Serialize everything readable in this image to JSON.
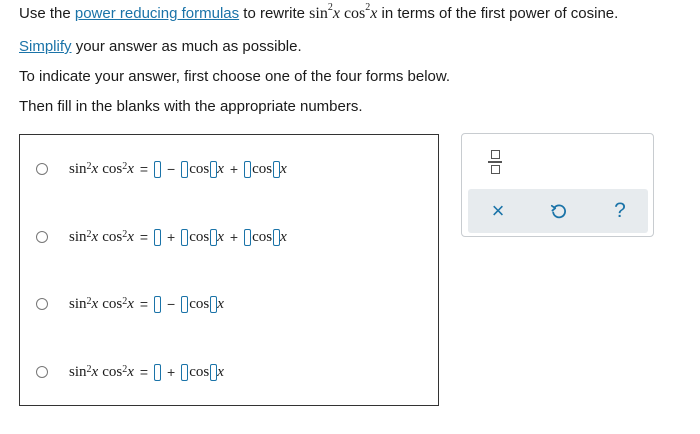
{
  "intro": {
    "prefix": "Use the",
    "link": "power reducing formulas",
    "middle": "to rewrite",
    "sin_fn": "sin",
    "exp": "2",
    "var": "x",
    "cos_fn": "cos",
    "suffix": "in terms of the first power of cosine."
  },
  "simplify": {
    "link": "Simplify",
    "rest": "your answer as much as possible."
  },
  "instruction1": "To indicate your answer, first choose one of the four forms below.",
  "instruction2": "Then fill in the blanks with the appropriate numbers.",
  "math": {
    "sin": "sin",
    "cos": "cos",
    "x": "x",
    "exp": "2",
    "eq": "=",
    "plus": "+",
    "minus": "−"
  },
  "options": [
    {
      "ops": [
        "−",
        "+"
      ]
    },
    {
      "ops": [
        "+",
        "+"
      ]
    },
    {
      "ops": [
        "−"
      ]
    },
    {
      "ops": [
        "+"
      ]
    }
  ],
  "tools": {
    "times": "×",
    "help": "?",
    "accent_color": "#1a73a8"
  }
}
